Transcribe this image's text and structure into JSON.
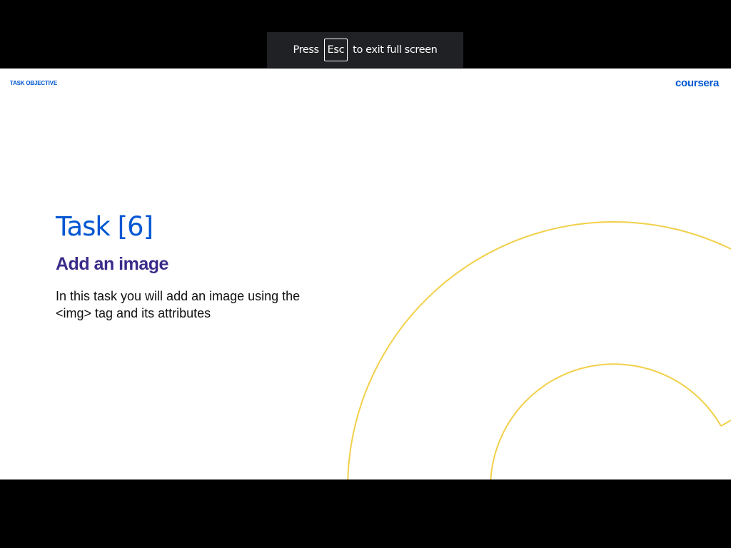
{
  "fullscreen_notice": {
    "press": "Press",
    "key": "Esc",
    "rest": "to exit full screen"
  },
  "slide": {
    "label": "TASK OBJECTIVE",
    "logo": "coursera",
    "title": "Task [6]",
    "subtitle": "Add an image",
    "description": "In this task you will add an image using the <img> tag and its attributes"
  },
  "colors": {
    "brand": "#0056d2",
    "subtitle": "#3b2b8a",
    "accent": "#f2d04a"
  }
}
